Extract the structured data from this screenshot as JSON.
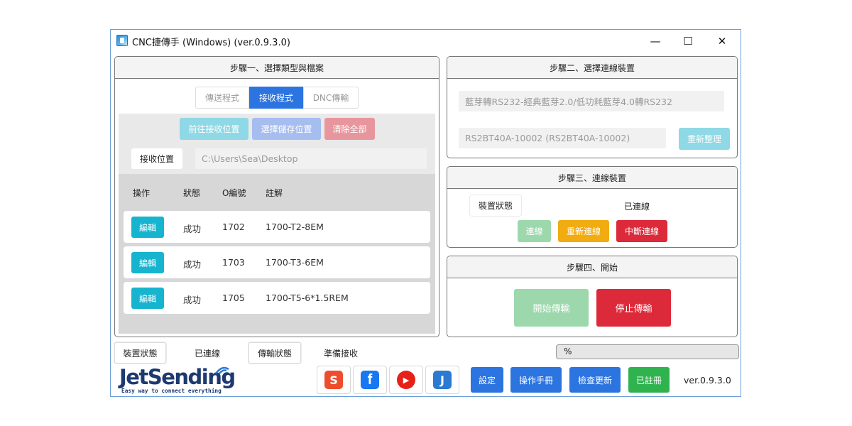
{
  "window": {
    "title": "CNC捷傳手 (Windows)  (ver.0.9.3.0)",
    "minimize": "—",
    "maximize": "☐",
    "close": "✕"
  },
  "step1": {
    "title": "步驟一、選擇類型與檔案",
    "tabs": [
      "傳送程式",
      "接收程式",
      "DNC傳輸"
    ],
    "active_tab": 1,
    "actions": {
      "goto_receive": "前往接收位置",
      "choose_save": "選擇儲存位置",
      "clear_all": "清除全部"
    },
    "receive_location_label": "接收位置",
    "receive_path": "C:\\Users\\Sea\\Desktop",
    "table": {
      "headers": [
        "操作",
        "狀態",
        "O編號",
        "註解"
      ],
      "rows": [
        {
          "action": "編輯",
          "status": "成功",
          "o_number": "1702",
          "comment": "1700-T2-8EM"
        },
        {
          "action": "編輯",
          "status": "成功",
          "o_number": "1703",
          "comment": "1700-T3-6EM"
        },
        {
          "action": "編輯",
          "status": "成功",
          "o_number": "1705",
          "comment": "1700-T5-6*1.5REM"
        }
      ]
    }
  },
  "step2": {
    "title": "步驟二、選擇連線裝置",
    "adapter": "藍芽轉RS232-經典藍芽2.0/低功耗藍芽4.0轉RS232",
    "device": "RS2BT40A-10002 (RS2BT40A-10002)",
    "refresh": "重新整理"
  },
  "step3": {
    "title": "步驟三、連線裝置",
    "device_status_label": "裝置狀態",
    "device_status_value": "已連線",
    "connect": "連線",
    "reconnect": "重新連線",
    "disconnect": "中斷連線"
  },
  "step4": {
    "title": "步驟四、開始",
    "start": "開始傳輸",
    "stop": "停止傳輸"
  },
  "status_bar": {
    "device_status_label": "裝置狀態",
    "device_status_value": "已連線",
    "transfer_status_label": "傳輸狀態",
    "transfer_status_value": "準備接收",
    "progress_text": "%",
    "progress": 0
  },
  "footer": {
    "logo_text": "JetSending",
    "logo_tagline": "Easy way to connect everything",
    "social": [
      "S",
      "f",
      "▶",
      "J"
    ],
    "settings": "設定",
    "manual": "操作手冊",
    "check_update": "檢查更新",
    "registered": "已註冊",
    "version": "ver.0.9.3.0"
  },
  "colors": {
    "blue": "#2c74e0",
    "cyan": "#17b4cf",
    "green": "#2fb34e",
    "red": "#dc2a3a",
    "orange": "#f1ac12",
    "shopee": "#ee4d2d",
    "facebook": "#1877f2",
    "youtube": "#e62117",
    "jet": "#2b7ad2"
  }
}
